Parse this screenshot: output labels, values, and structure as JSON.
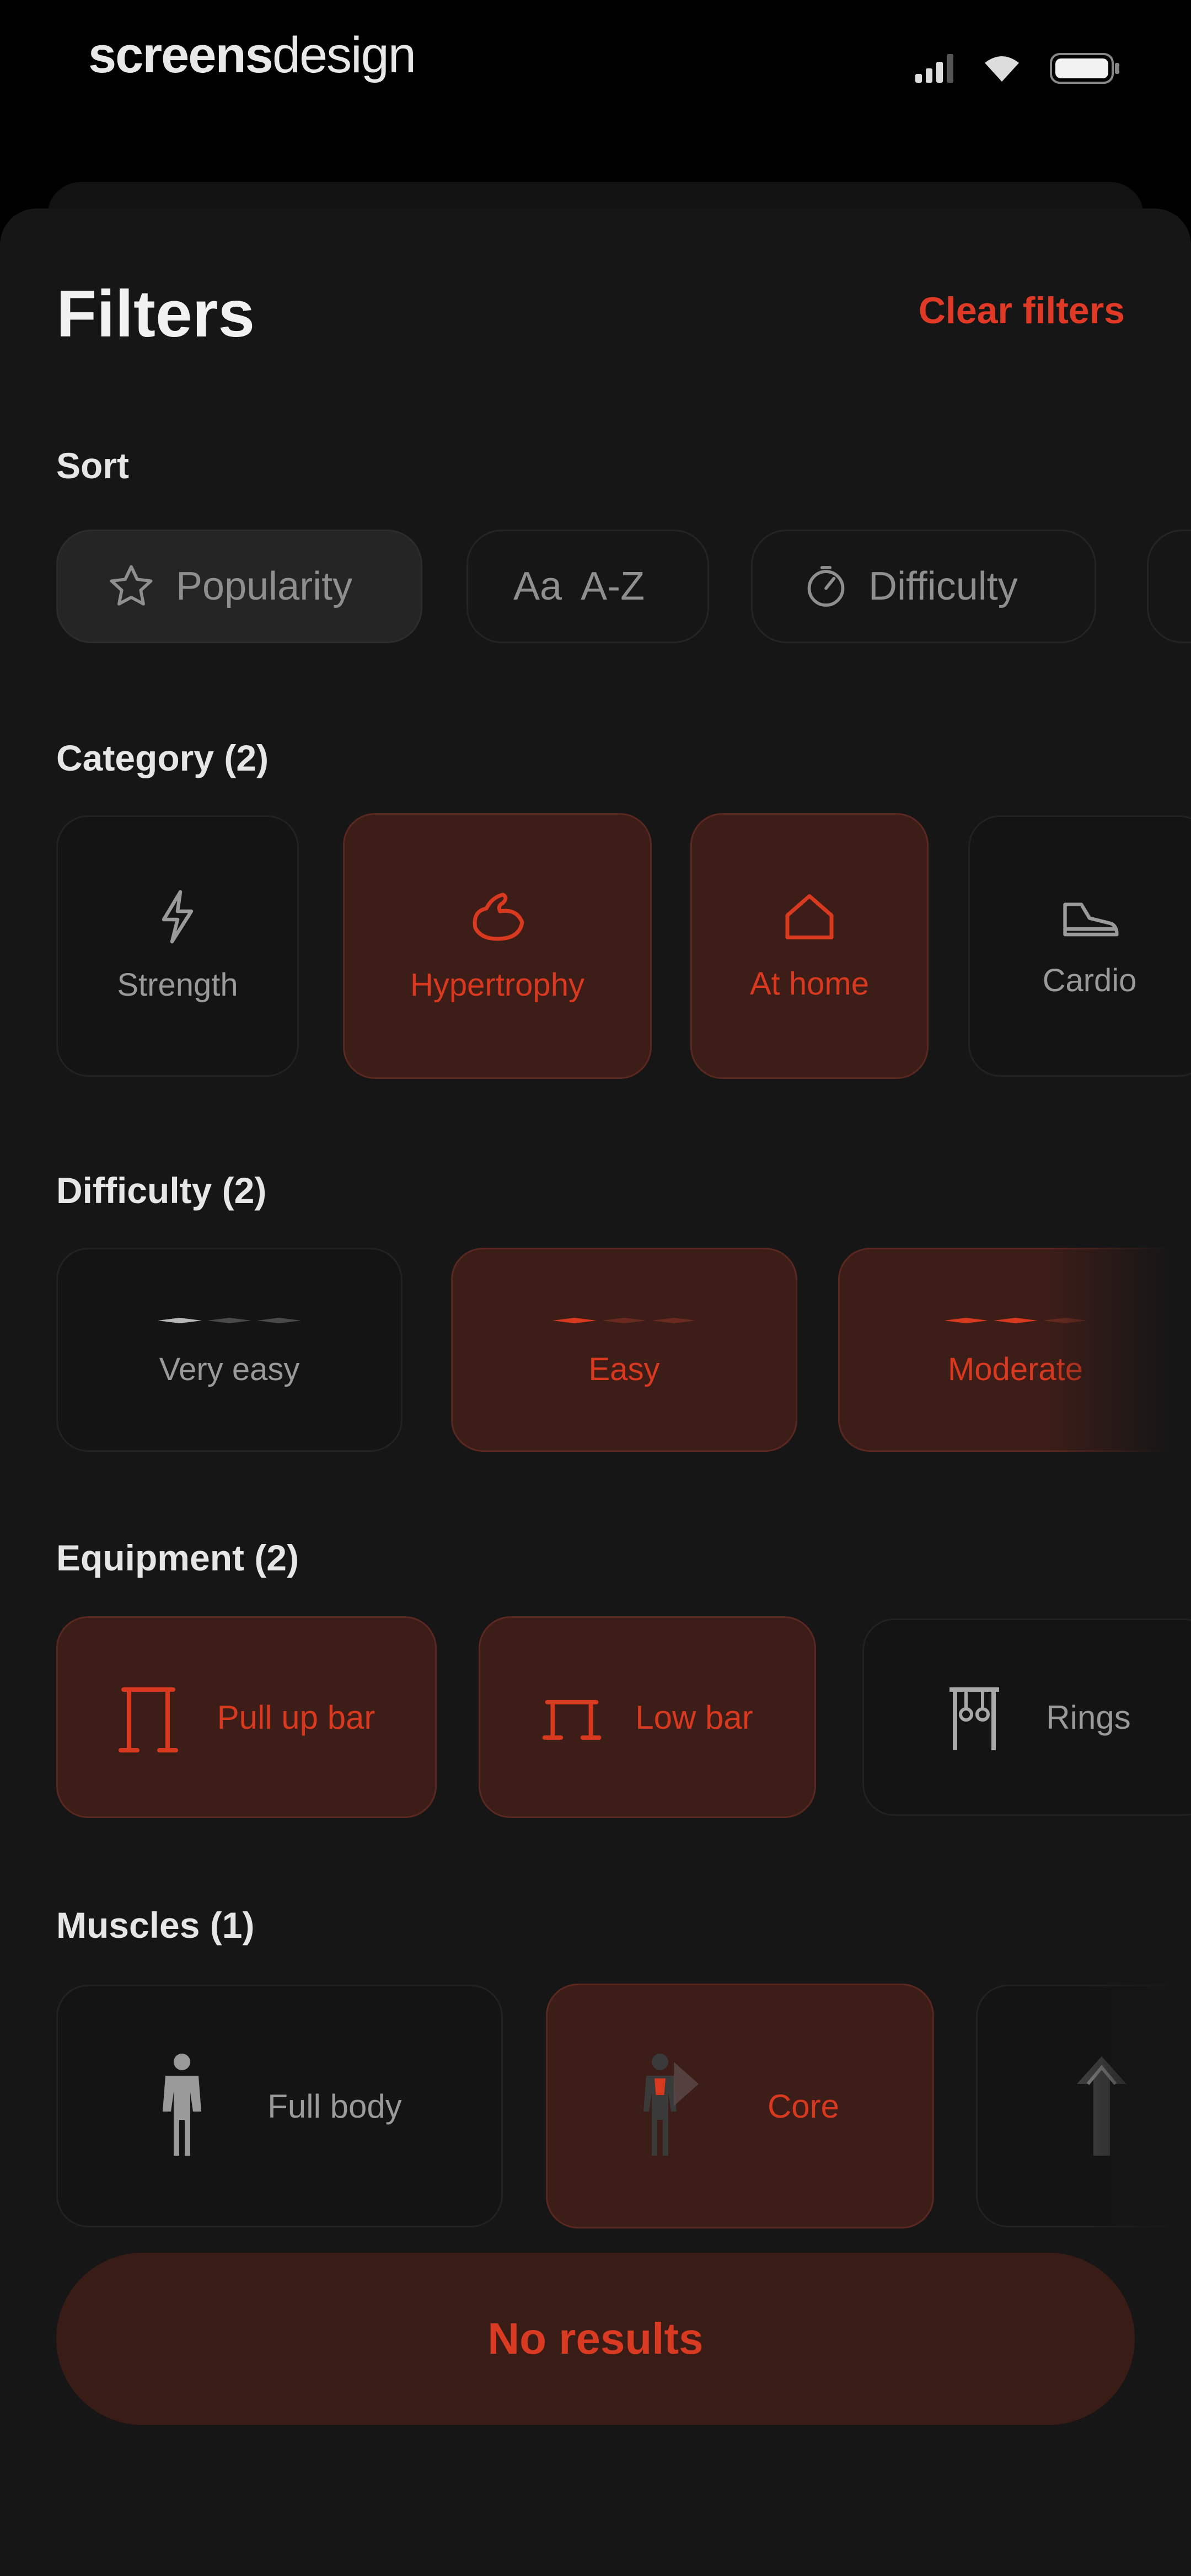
{
  "status_bar": {
    "brand_bold": "screens",
    "brand_light": "design",
    "icons": [
      "signal-icon",
      "wifi-icon",
      "battery-icon"
    ]
  },
  "header": {
    "title": "Filters",
    "clear_label": "Clear filters"
  },
  "sort": {
    "label": "Sort",
    "options": [
      {
        "label": "Popularity",
        "icon": "star-icon",
        "selected": true
      },
      {
        "label": "A-Z",
        "icon": "alphabet-icon",
        "icon_text": "Aa",
        "selected": false
      },
      {
        "label": "Difficulty",
        "icon": "gauge-icon",
        "selected": false
      }
    ]
  },
  "category": {
    "label": "Category (2)",
    "items": [
      {
        "label": "Strength",
        "icon": "lightning-icon",
        "selected": false
      },
      {
        "label": "Hypertrophy",
        "icon": "muscle-icon",
        "selected": true
      },
      {
        "label": "At home",
        "icon": "house-icon",
        "selected": true
      },
      {
        "label": "Cardio",
        "icon": "shoe-icon",
        "selected": false
      }
    ]
  },
  "difficulty": {
    "label": "Difficulty (2)",
    "items": [
      {
        "label": "Very easy",
        "level": 1,
        "selected": false
      },
      {
        "label": "Easy",
        "level": 1,
        "selected": true
      },
      {
        "label": "Moderate",
        "level": 2,
        "selected": true
      }
    ]
  },
  "equipment": {
    "label": "Equipment (2)",
    "items": [
      {
        "label": "Pull up bar",
        "icon": "pull-up-bar-icon",
        "selected": true
      },
      {
        "label": "Low bar",
        "icon": "low-bar-icon",
        "selected": true
      },
      {
        "label": "Rings",
        "icon": "rings-icon",
        "selected": false
      }
    ]
  },
  "muscles": {
    "label": "Muscles (1)",
    "items": [
      {
        "label": "Full body",
        "icon": "body-figure-icon",
        "selected": false
      },
      {
        "label": "Core",
        "icon": "core-figure-icon",
        "selected": true
      },
      {
        "label": "",
        "icon": "upper-body-figure-icon",
        "selected": false
      }
    ]
  },
  "cta": {
    "label": "No results"
  },
  "colors": {
    "accent": "#e03a26",
    "selected_bg": "#3c1d18",
    "background": "#161616"
  }
}
